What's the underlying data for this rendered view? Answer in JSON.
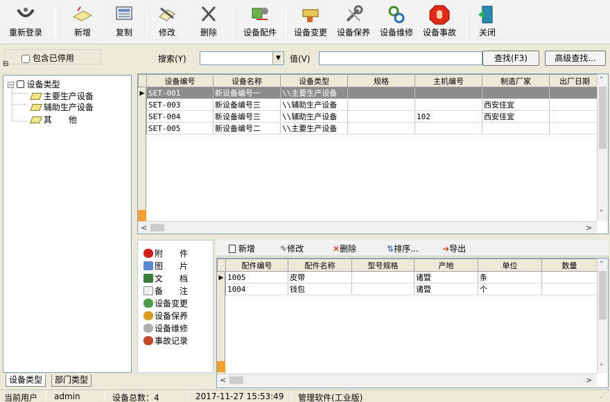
{
  "toolbar": {
    "relogin": "重新登录",
    "add": "新增",
    "copy": "复制",
    "edit": "修改",
    "delete": "删除",
    "parts": "设备配件",
    "change": "设备变更",
    "maintain": "设备保养",
    "repair": "设备维修",
    "accident": "设备事故",
    "close": "关闭"
  },
  "search": {
    "include_disabled": "包含已停用",
    "search_label": "搜索(Y)",
    "search_value": "",
    "value_label": "值(V)",
    "value_input": "",
    "find_button": "查找(F3)",
    "advanced_button": "高级查找..."
  },
  "tree": {
    "root": "设备类型",
    "items": [
      "主要生产设备",
      "辅助生产设备",
      "其　　他"
    ]
  },
  "left_tabs": [
    "设备类型",
    "部门类型"
  ],
  "main_grid": {
    "columns": [
      "设备编号",
      "设备名称",
      "设备类型",
      "规格",
      "主机编号",
      "制造厂家",
      "出厂日期"
    ],
    "rows": [
      [
        "SET-001",
        "新设备编号一",
        "\\\\主要生产设备",
        "",
        "",
        "",
        ""
      ],
      [
        "SET-003",
        "新设备编号三",
        "\\\\辅助生产设备",
        "",
        "",
        "西安佳宜",
        ""
      ],
      [
        "SET-004",
        "新设备编号三",
        "\\\\辅助生产设备",
        "",
        "102",
        "西安佳宜",
        ""
      ],
      [
        "SET-005",
        "新设备编号二",
        "\\\\主要生产设备",
        "",
        "",
        "",
        ""
      ]
    ]
  },
  "side_list": [
    "附　　件",
    "图　　片",
    "文　　档",
    "备　　注",
    "设备变更",
    "设备保养",
    "设备维修",
    "事故记录"
  ],
  "sub_toolbar": {
    "add": "新增",
    "edit": "修改",
    "delete": "删除",
    "sort": "排序...",
    "export": "导出"
  },
  "parts_grid": {
    "columns": [
      "配件编号",
      "配件名称",
      "型号规格",
      "产地",
      "单位",
      "数量"
    ],
    "rows": [
      [
        "1005",
        "皮带",
        "",
        "诸暨",
        "条",
        ""
      ],
      [
        "1004",
        "钱包",
        "",
        "诸暨",
        "个",
        ""
      ]
    ]
  },
  "status": {
    "user_label": "当前用户",
    "user": "admin",
    "total": "设备总数：4",
    "datetime": "2017-11-27 15:53:49",
    "product": "管理软件(工业版)"
  }
}
